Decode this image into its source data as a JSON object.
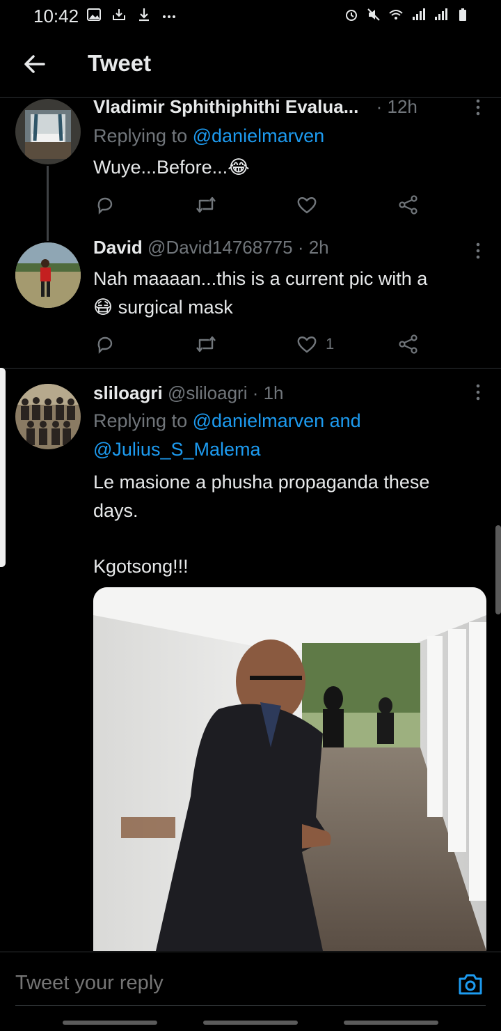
{
  "status_bar": {
    "time": "10:42"
  },
  "header": {
    "title": "Tweet"
  },
  "tweets": [
    {
      "name": "Vladimir Sphithiphithi Evalua...",
      "handle": "",
      "time": "· 12h",
      "replying_prefix": "Replying to",
      "replying_to": "@danielmarven",
      "text": "Wuye...Before...😂",
      "likes": ""
    },
    {
      "name": "David",
      "handle": "@David14768775",
      "time": "· 2h",
      "text_line1": "Nah maaaan...this is a current pic with a",
      "text_line2": "😷 surgical mask",
      "likes": "1"
    },
    {
      "name": "sliloagri",
      "handle": "@sliloagri",
      "time": "· 1h",
      "replying_prefix": "Replying to",
      "replying_to": "@danielmarven",
      "replying_and": "and",
      "replying_to_2": "@Julius_S_Malema",
      "text_line1": "Le masione a phusha propaganda these",
      "text_line2": "days.",
      "text_line3": "Kgotsong!!!"
    }
  ],
  "reply_bar": {
    "placeholder": "Tweet your reply"
  },
  "icons": {
    "accent": "#1d9bf0",
    "muted": "#71767b"
  }
}
